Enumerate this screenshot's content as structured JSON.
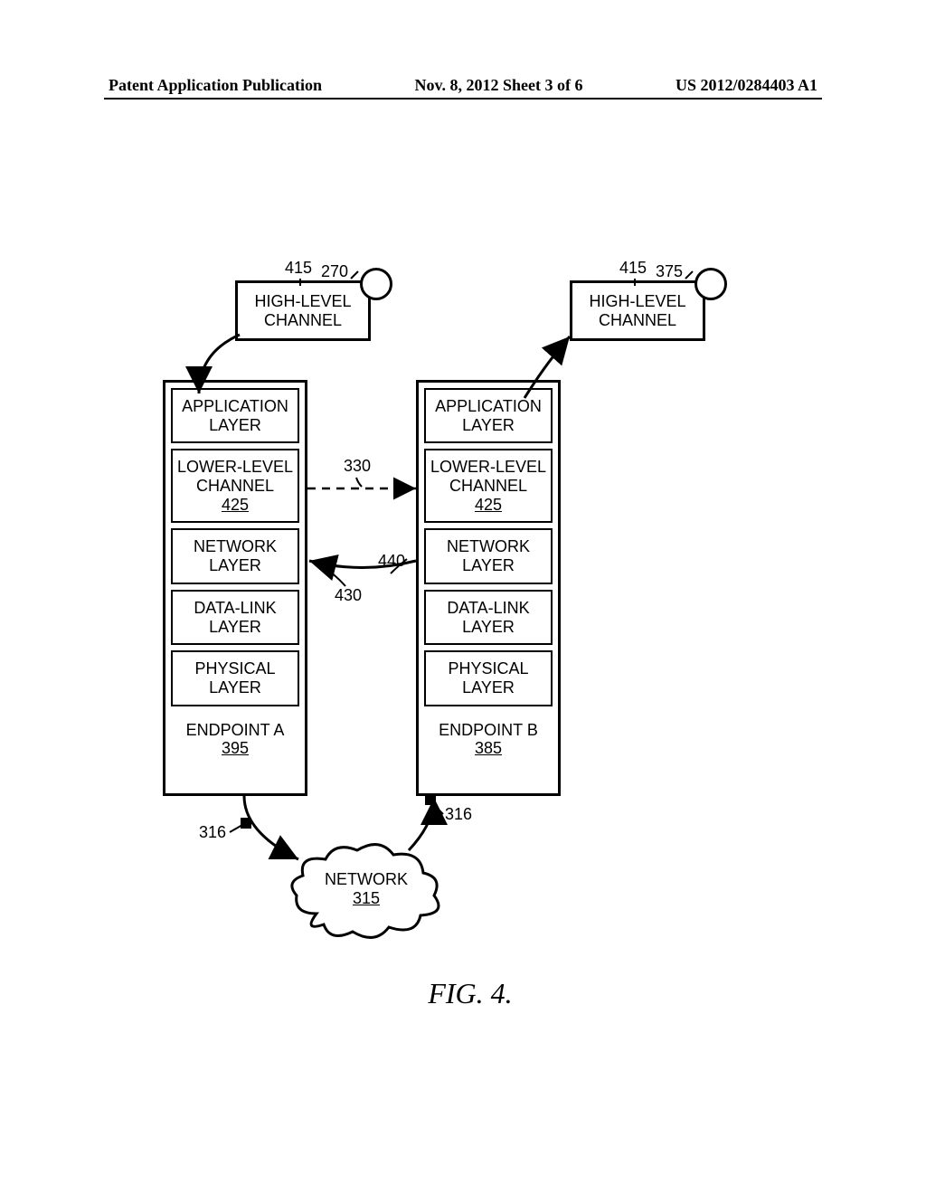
{
  "header": {
    "left": "Patent Application Publication",
    "center": "Nov. 8, 2012   Sheet 3 of 6",
    "right": "US 2012/0284403 A1"
  },
  "hlc": {
    "label": "HIGH-LEVEL\nCHANNEL"
  },
  "layers": {
    "app": "APPLICATION\nLAYER",
    "llc": "LOWER-LEVEL\nCHANNEL",
    "llc_ref": "425",
    "net": "NETWORK\nLAYER",
    "dl": "DATA-LINK\nLAYER",
    "phy": "PHYSICAL\nLAYER"
  },
  "endpointA": {
    "name": "ENDPOINT A",
    "ref": "395"
  },
  "endpointB": {
    "name": "ENDPOINT B",
    "ref": "385"
  },
  "network": {
    "name": "NETWORK",
    "ref": "315"
  },
  "labels": {
    "l415a": "415",
    "l415b": "415",
    "l270": "270",
    "l375": "375",
    "l330": "330",
    "l430": "430",
    "l440": "440",
    "l316a": "316",
    "l316b": "316"
  },
  "figure": "FIG. 4."
}
